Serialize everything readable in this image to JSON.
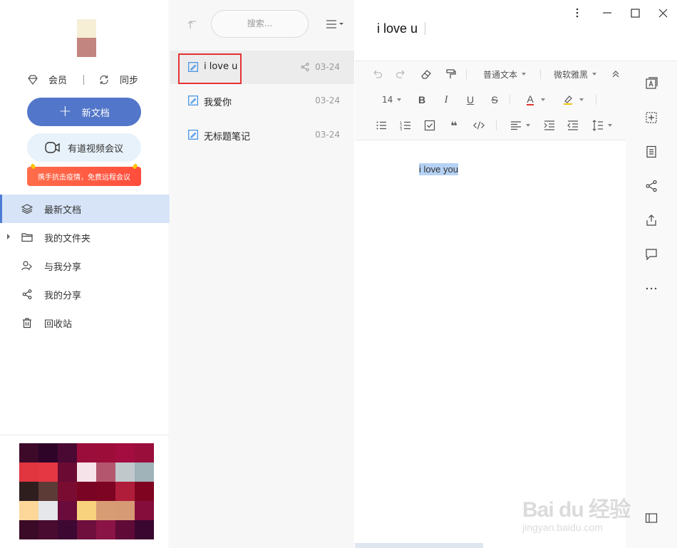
{
  "sidebar": {
    "member_label": "会员",
    "sync_label": "同步",
    "new_doc_label": "新文档",
    "video_meeting_label": "有道视频会议",
    "promo_text": "携手抗击疫情，免费远程会议",
    "nav": [
      {
        "label": "最新文档",
        "icon": "layers-icon",
        "active": true
      },
      {
        "label": "我的文件夹",
        "icon": "folder-icon",
        "active": false
      },
      {
        "label": "与我分享",
        "icon": "shared-with-me-icon",
        "active": false
      },
      {
        "label": "我的分享",
        "icon": "share-icon",
        "active": false
      },
      {
        "label": "回收站",
        "icon": "trash-icon",
        "active": false
      }
    ],
    "avatar_colors": [
      "#f6efd5",
      "#c3857f"
    ],
    "thumbnail_colors": [
      "#3d0a2a",
      "#2e0528",
      "#4a0932",
      "#9b0d3a",
      "#9c0d39",
      "#a30d3f",
      "#9a0e3c",
      "#e1353f",
      "#e53643",
      "#6b0b33",
      "#f6e3ea",
      "#b5566f",
      "#c0c8cc",
      "#9fb3b9",
      "#2e1e1e",
      "#5c3b37",
      "#7a0c31",
      "#7a0424",
      "#7d0423",
      "#b01d3a",
      "#7f0420",
      "#fdd79a",
      "#e5e7eb",
      "#6b0b3b",
      "#f8d27d",
      "#d89c74",
      "#d69a74",
      "#840d3b",
      "#3a0a26",
      "#4a0b30",
      "#3d0832",
      "#6e0f3d",
      "#8a1445",
      "#5f0a37",
      "#3a0730"
    ]
  },
  "list": {
    "search_placeholder": "搜索...",
    "notes": [
      {
        "title": "i love u",
        "date": "03-24",
        "shared": true,
        "active": true
      },
      {
        "title": "我爱你",
        "date": "03-24",
        "shared": false,
        "active": false
      },
      {
        "title": "无标题笔记",
        "date": "03-24",
        "shared": false,
        "active": false
      }
    ]
  },
  "editor": {
    "title": "i love u",
    "content": "i love you",
    "toolbar": {
      "paragraph_style": "普通文本",
      "font_family": "微软雅黑",
      "font_size": "14"
    }
  },
  "watermark": {
    "line1": "Bai du 经验",
    "line2": "jingyan.baidu.com"
  },
  "colors": {
    "accent": "#5276c9",
    "active_nav_bg": "#d7e4f8",
    "selection": "#b5d1f4",
    "highlight_box": "#e53333"
  }
}
